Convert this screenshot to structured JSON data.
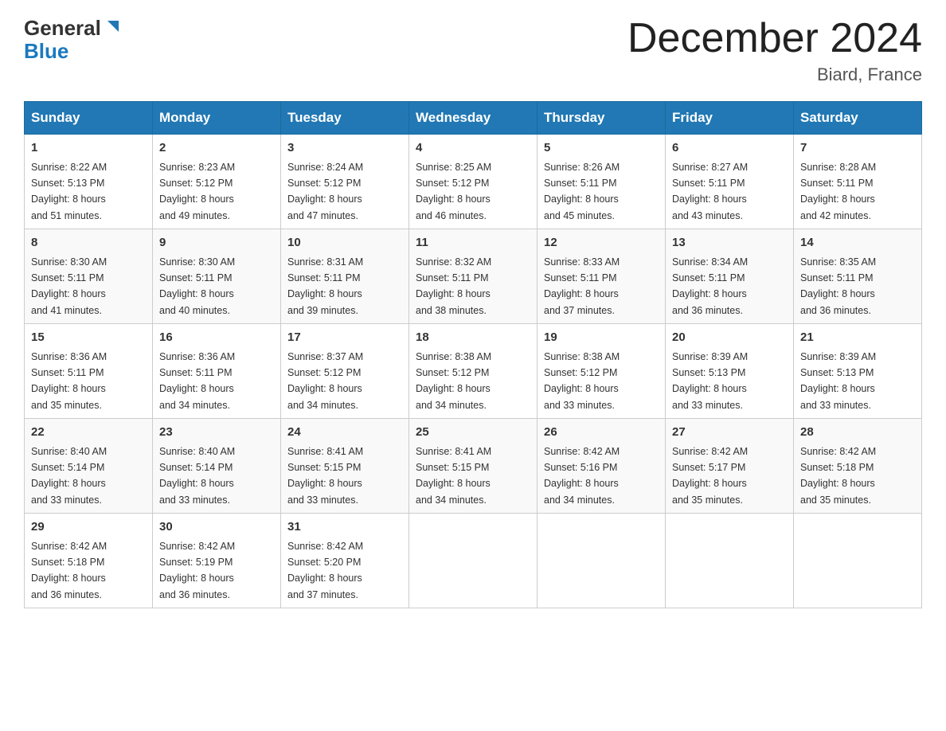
{
  "header": {
    "logo_general": "General",
    "logo_blue": "Blue",
    "month_title": "December 2024",
    "location": "Biard, France"
  },
  "weekdays": [
    "Sunday",
    "Monday",
    "Tuesday",
    "Wednesday",
    "Thursday",
    "Friday",
    "Saturday"
  ],
  "weeks": [
    [
      {
        "day": "1",
        "sunrise": "8:22 AM",
        "sunset": "5:13 PM",
        "daylight": "8 hours and 51 minutes."
      },
      {
        "day": "2",
        "sunrise": "8:23 AM",
        "sunset": "5:12 PM",
        "daylight": "8 hours and 49 minutes."
      },
      {
        "day": "3",
        "sunrise": "8:24 AM",
        "sunset": "5:12 PM",
        "daylight": "8 hours and 47 minutes."
      },
      {
        "day": "4",
        "sunrise": "8:25 AM",
        "sunset": "5:12 PM",
        "daylight": "8 hours and 46 minutes."
      },
      {
        "day": "5",
        "sunrise": "8:26 AM",
        "sunset": "5:11 PM",
        "daylight": "8 hours and 45 minutes."
      },
      {
        "day": "6",
        "sunrise": "8:27 AM",
        "sunset": "5:11 PM",
        "daylight": "8 hours and 43 minutes."
      },
      {
        "day": "7",
        "sunrise": "8:28 AM",
        "sunset": "5:11 PM",
        "daylight": "8 hours and 42 minutes."
      }
    ],
    [
      {
        "day": "8",
        "sunrise": "8:30 AM",
        "sunset": "5:11 PM",
        "daylight": "8 hours and 41 minutes."
      },
      {
        "day": "9",
        "sunrise": "8:30 AM",
        "sunset": "5:11 PM",
        "daylight": "8 hours and 40 minutes."
      },
      {
        "day": "10",
        "sunrise": "8:31 AM",
        "sunset": "5:11 PM",
        "daylight": "8 hours and 39 minutes."
      },
      {
        "day": "11",
        "sunrise": "8:32 AM",
        "sunset": "5:11 PM",
        "daylight": "8 hours and 38 minutes."
      },
      {
        "day": "12",
        "sunrise": "8:33 AM",
        "sunset": "5:11 PM",
        "daylight": "8 hours and 37 minutes."
      },
      {
        "day": "13",
        "sunrise": "8:34 AM",
        "sunset": "5:11 PM",
        "daylight": "8 hours and 36 minutes."
      },
      {
        "day": "14",
        "sunrise": "8:35 AM",
        "sunset": "5:11 PM",
        "daylight": "8 hours and 36 minutes."
      }
    ],
    [
      {
        "day": "15",
        "sunrise": "8:36 AM",
        "sunset": "5:11 PM",
        "daylight": "8 hours and 35 minutes."
      },
      {
        "day": "16",
        "sunrise": "8:36 AM",
        "sunset": "5:11 PM",
        "daylight": "8 hours and 34 minutes."
      },
      {
        "day": "17",
        "sunrise": "8:37 AM",
        "sunset": "5:12 PM",
        "daylight": "8 hours and 34 minutes."
      },
      {
        "day": "18",
        "sunrise": "8:38 AM",
        "sunset": "5:12 PM",
        "daylight": "8 hours and 34 minutes."
      },
      {
        "day": "19",
        "sunrise": "8:38 AM",
        "sunset": "5:12 PM",
        "daylight": "8 hours and 33 minutes."
      },
      {
        "day": "20",
        "sunrise": "8:39 AM",
        "sunset": "5:13 PM",
        "daylight": "8 hours and 33 minutes."
      },
      {
        "day": "21",
        "sunrise": "8:39 AM",
        "sunset": "5:13 PM",
        "daylight": "8 hours and 33 minutes."
      }
    ],
    [
      {
        "day": "22",
        "sunrise": "8:40 AM",
        "sunset": "5:14 PM",
        "daylight": "8 hours and 33 minutes."
      },
      {
        "day": "23",
        "sunrise": "8:40 AM",
        "sunset": "5:14 PM",
        "daylight": "8 hours and 33 minutes."
      },
      {
        "day": "24",
        "sunrise": "8:41 AM",
        "sunset": "5:15 PM",
        "daylight": "8 hours and 33 minutes."
      },
      {
        "day": "25",
        "sunrise": "8:41 AM",
        "sunset": "5:15 PM",
        "daylight": "8 hours and 34 minutes."
      },
      {
        "day": "26",
        "sunrise": "8:42 AM",
        "sunset": "5:16 PM",
        "daylight": "8 hours and 34 minutes."
      },
      {
        "day": "27",
        "sunrise": "8:42 AM",
        "sunset": "5:17 PM",
        "daylight": "8 hours and 35 minutes."
      },
      {
        "day": "28",
        "sunrise": "8:42 AM",
        "sunset": "5:18 PM",
        "daylight": "8 hours and 35 minutes."
      }
    ],
    [
      {
        "day": "29",
        "sunrise": "8:42 AM",
        "sunset": "5:18 PM",
        "daylight": "8 hours and 36 minutes."
      },
      {
        "day": "30",
        "sunrise": "8:42 AM",
        "sunset": "5:19 PM",
        "daylight": "8 hours and 36 minutes."
      },
      {
        "day": "31",
        "sunrise": "8:42 AM",
        "sunset": "5:20 PM",
        "daylight": "8 hours and 37 minutes."
      },
      null,
      null,
      null,
      null
    ]
  ],
  "labels": {
    "sunrise": "Sunrise:",
    "sunset": "Sunset:",
    "daylight": "Daylight:"
  }
}
